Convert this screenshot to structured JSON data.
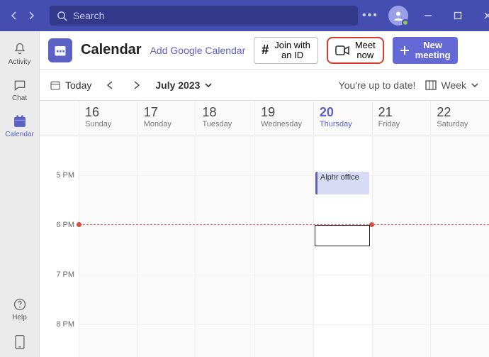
{
  "search": {
    "placeholder": "Search"
  },
  "sidebar": {
    "items": [
      {
        "label": "Activity"
      },
      {
        "label": "Chat"
      },
      {
        "label": "Calendar"
      },
      {
        "label": "Help"
      }
    ]
  },
  "toolbar": {
    "title": "Calendar",
    "add_google": "Add Google Calendar",
    "join_id": {
      "line1": "Join with",
      "line2": "an ID"
    },
    "meet_now": {
      "line1": "Meet",
      "line2": "now"
    },
    "new_meeting": {
      "line1": "New",
      "line2": "meeting"
    }
  },
  "subbar": {
    "today": "Today",
    "month": "July 2023",
    "status": "You're up to date!",
    "view": "Week"
  },
  "days": [
    {
      "num": "16",
      "name": "Sunday"
    },
    {
      "num": "17",
      "name": "Monday"
    },
    {
      "num": "18",
      "name": "Tuesday"
    },
    {
      "num": "19",
      "name": "Wednesday"
    },
    {
      "num": "20",
      "name": "Thursday"
    },
    {
      "num": "21",
      "name": "Friday"
    },
    {
      "num": "22",
      "name": "Saturday"
    }
  ],
  "hours": [
    "5 PM",
    "6 PM",
    "7 PM",
    "8 PM"
  ],
  "event": {
    "title": "Alphr office"
  }
}
